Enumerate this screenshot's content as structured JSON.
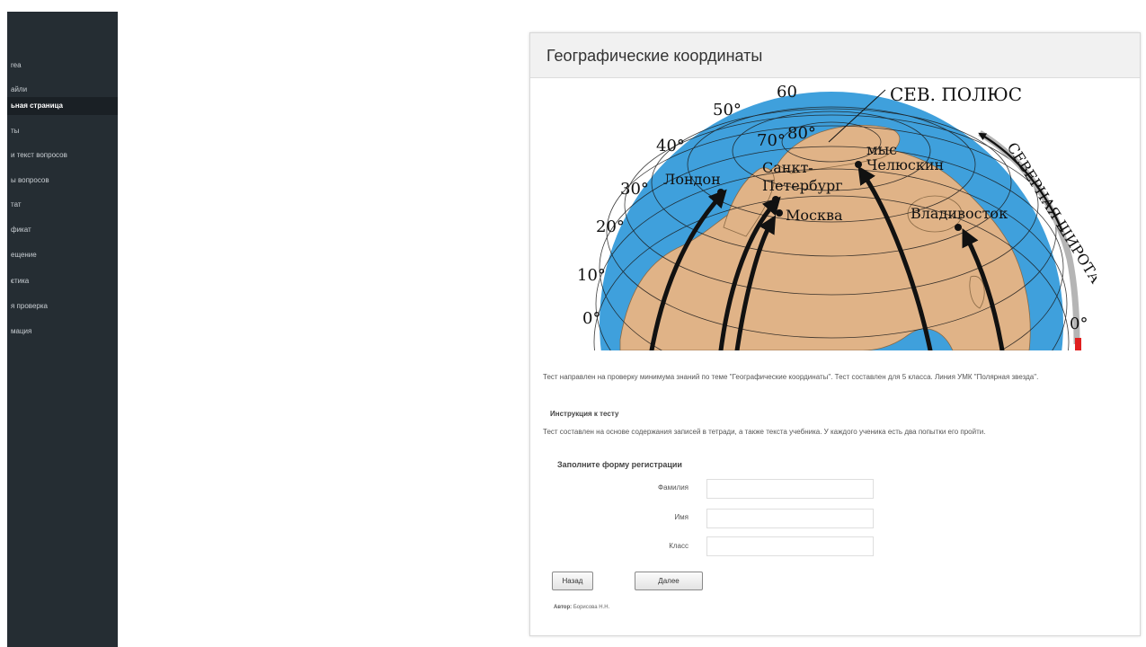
{
  "sidebar": {
    "items": [
      {
        "label": "rea"
      },
      {
        "label": "айли"
      },
      {
        "label": "ьная страница",
        "active": true
      },
      {
        "label": "ты"
      },
      {
        "label": "и текст вопросов"
      },
      {
        "label": "ы вопросов"
      },
      {
        "label": "тат"
      },
      {
        "label": "фикат"
      },
      {
        "label": "ещение"
      },
      {
        "label": "стика",
        "arrow": "›"
      },
      {
        "label": "я проверка"
      },
      {
        "label": "мация"
      }
    ]
  },
  "panel": {
    "title": "Географические координаты",
    "globe": {
      "lat_labels": [
        "60",
        "50°",
        "40°",
        "30°",
        "20°",
        "10°",
        "0°",
        "70°",
        "80°",
        "0°"
      ],
      "pole_label": "СЕВ. ПОЛЮС",
      "arc_label": "СЕВЕРНАЯ ШИРОТА",
      "cities": {
        "london": "Лондон",
        "spb_1": "Санкт-",
        "spb_2": "Петербург",
        "moscow": "Москва",
        "cape_1": "мыс",
        "cape_2": "Челюскин",
        "vladivostok": "Владивосток"
      }
    },
    "description": "Тест направлен на проверку минимума знаний по теме \"Географические координаты\". Тест составлен для 5 класса. Линия УМК \"Полярная звезда\".",
    "instruction_title": "Инструкция к тесту",
    "instruction_text": "Тест составлен на основе содержания записей в тетради, а также текста учебника. У каждого ученика есть два попытки его пройти.",
    "form": {
      "title": "Заполните форму регистрации",
      "fields": [
        {
          "label": "Фамилия",
          "value": ""
        },
        {
          "label": "Имя",
          "value": ""
        },
        {
          "label": "Класс",
          "value": ""
        }
      ]
    },
    "buttons": {
      "back": "Назад",
      "next": "Далее"
    },
    "author_label": "Автор:",
    "author_name": "Борисова Н.Н."
  },
  "colors": {
    "sidebar": "#252d33",
    "ocean": "#3fa0dc",
    "land": "#e0b387"
  }
}
